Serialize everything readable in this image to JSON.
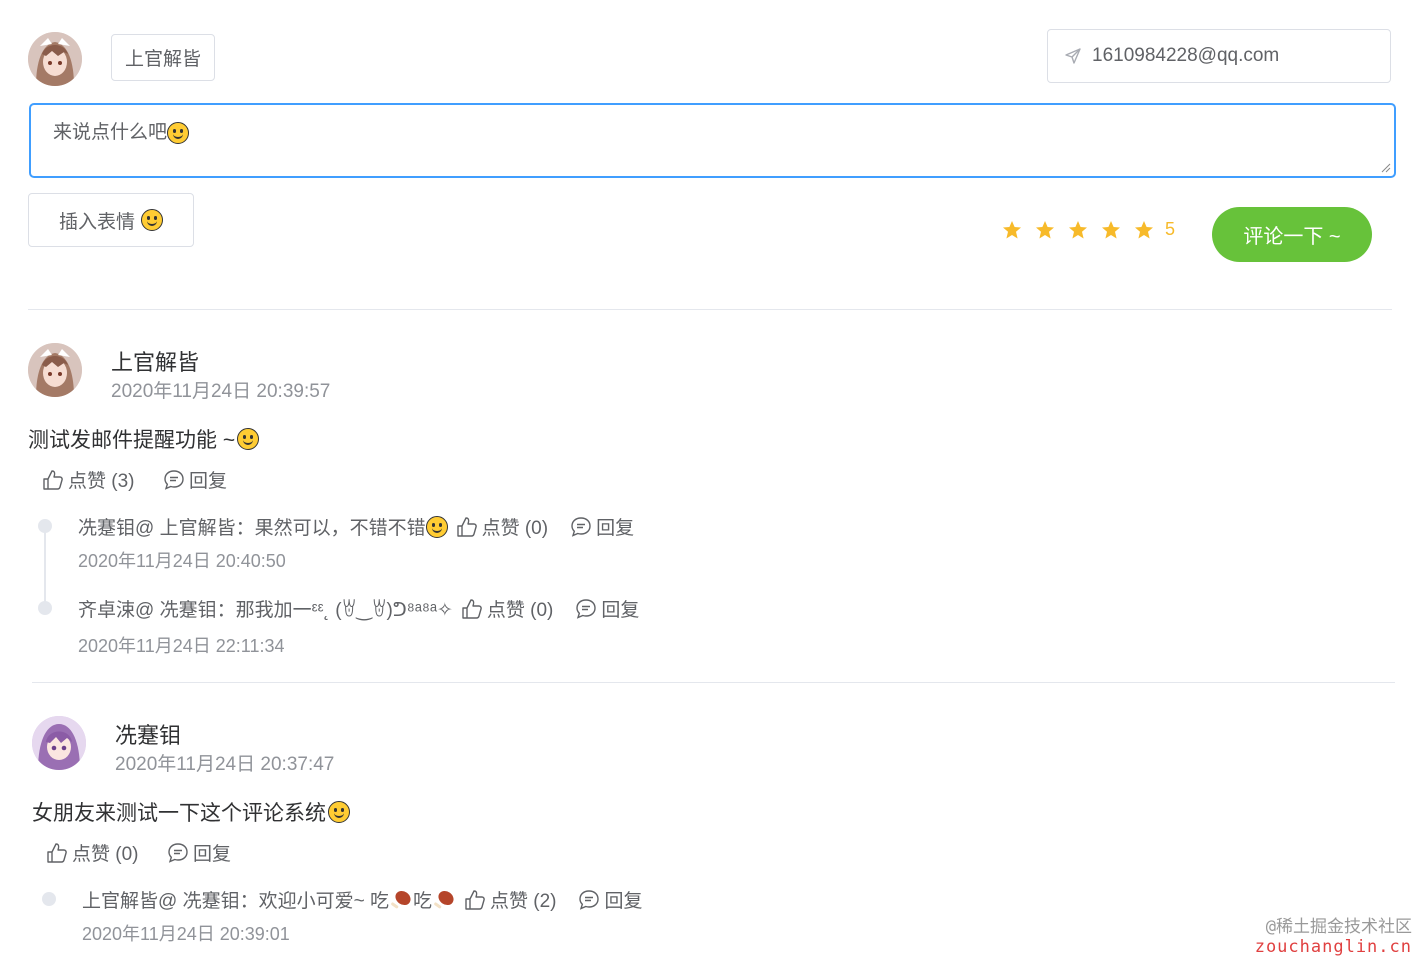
{
  "form": {
    "username": "上官解皆",
    "email": "1610984228@qq.com",
    "textarea_placeholder": "来说点什么吧",
    "emoji_button_label": "插入表情",
    "rating_score": "5",
    "rating_value": 5,
    "submit_label": "评论一下 ~"
  },
  "comments": [
    {
      "author": "上官解皆",
      "time": "2020年11月24日 20:39:57",
      "content": "测试发邮件提醒功能 ~",
      "like_label": "点赞 (3)",
      "reply_label": "回复",
      "replies": [
        {
          "text": "冼蹇钼@ 上官解皆：果然可以，不错不错",
          "like_label": "点赞 (0)",
          "reply_label": "回复",
          "time": "2020年11月24日 20:40:50"
        },
        {
          "text": "齐卓涑@ 冼蹇钼：那我加一ᵋᵋ˛ (ꇐ‿ꇐ)ᕤ⁸ᵃ⁸ᵃ✧",
          "like_label": "点赞 (0)",
          "reply_label": "回复",
          "time": "2020年11月24日 22:11:34"
        }
      ]
    },
    {
      "author": "冼蹇钼",
      "time": "2020年11月24日 20:37:47",
      "content": "女朋友来测试一下这个评论系统",
      "like_label": "点赞 (0)",
      "reply_label": "回复",
      "replies": [
        {
          "text": "上官解皆@ 冼蹇钼：欢迎小可爱~ 吃",
          "text2": "吃",
          "like_label": "点赞 (2)",
          "reply_label": "回复",
          "time": "2020年11月24日 20:39:01"
        }
      ]
    }
  ],
  "watermark": {
    "line1": "@稀土掘金技术社区",
    "line2": "zouchanglin.cn"
  },
  "colors": {
    "accent": "#409eff",
    "submit": "#67c23a",
    "star": "#f7ba2a"
  }
}
